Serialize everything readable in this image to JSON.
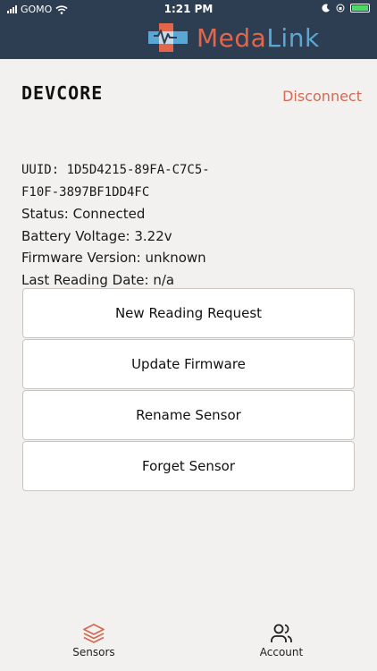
{
  "status_bar": {
    "carrier": "GOMO",
    "time": "1:21 PM"
  },
  "brand": {
    "name_part1": "Meda",
    "name_part2": "Link",
    "colors": {
      "red": "#e4664a",
      "blue": "#5aa7d6",
      "header": "#2e3e52"
    }
  },
  "device": {
    "name": "DEVCORE",
    "disconnect_label": "Disconnect",
    "uuid_line1": "UUID: 1D5D4215-89FA-C7C5-",
    "uuid_line2": "F10F-3897BF1DD4FC",
    "status": "Status: Connected",
    "battery": "Battery Voltage: 3.22v",
    "firmware": "Firmware Version: unknown",
    "last_reading": "Last Reading Date: n/a"
  },
  "actions": {
    "new_reading": "New Reading Request",
    "update_firmware": "Update Firmware",
    "rename": "Rename Sensor",
    "forget": "Forget Sensor"
  },
  "tabs": {
    "sensors": "Sensors",
    "account": "Account"
  },
  "icons": {
    "sensors": "layers-icon",
    "account": "users-icon"
  }
}
